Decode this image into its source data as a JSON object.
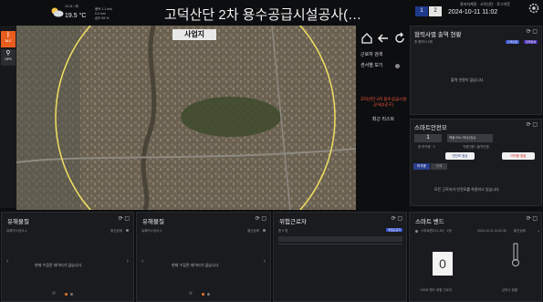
{
  "header": {
    "weather": {
      "date": "10-11 / 화",
      "temp": "19.5 °C",
      "wind": "풍속 1.1 m/s",
      "rain": "0.0 mm",
      "humidity": "습도 65 %"
    },
    "title": "고덕산단 2차 용수공급시설공사(…",
    "pages": [
      "1",
      "2"
    ],
    "top_info": "관리자계정 ·  고덕산단  ·  로그아웃",
    "datetime": "2024-10-11 11:02"
  },
  "sidebar": {
    "items": [
      {
        "label": "BLE"
      },
      {
        "label": "GPS"
      }
    ]
  },
  "map": {
    "label": "사업지"
  },
  "map_controls": {
    "menu": [
      "근로자 검색",
      "센서별 보기",
      "고덕산단 2차 용수공급시설공사(2공구)",
      "최근 리스트"
    ],
    "highlight_color": "#ff5a3c"
  },
  "access": {
    "title": "협력사별 출역 현황",
    "count_label": "총 협력사 0명",
    "badges": [
      "출역인원",
      "협력업체"
    ],
    "empty": "출역 인원이 없습니다."
  },
  "safety": {
    "title": "스마트안전모",
    "count": "1",
    "status_label": "작동 0% / 미수신(1)",
    "caption1": "총 미착용 : 0",
    "caption2": "착용인원 / 불착인원",
    "btn_check": "안전모 점검",
    "btn_unworn": "미착용 알림",
    "tabs": [
      "미착용",
      "전체"
    ],
    "empty": "모든 근로자가 안전모를 착용하고 있습니다."
  },
  "gas1": {
    "title": "유해물질",
    "device": "유해가스센서-1",
    "status": "통신상태",
    "empty": "현재 수집된 데이터가 없습니다."
  },
  "gas2": {
    "title": "유해물질",
    "device": "유해가스센서-2",
    "status": "통신상태",
    "empty": "현재 수집된 데이터가 없습니다."
  },
  "danger": {
    "title": "위험근로자",
    "count_label": "총 0 명",
    "badge": "위험근로자"
  },
  "band": {
    "title": "스마트 밴드",
    "device": "스마트밴드(1-10) · 1명",
    "ts": "2024-10-11 11:02:30",
    "status": "통신상태",
    "value": "0",
    "label1": "스마트 밴드 위험 근로자",
    "label2": "심박수 현황"
  }
}
